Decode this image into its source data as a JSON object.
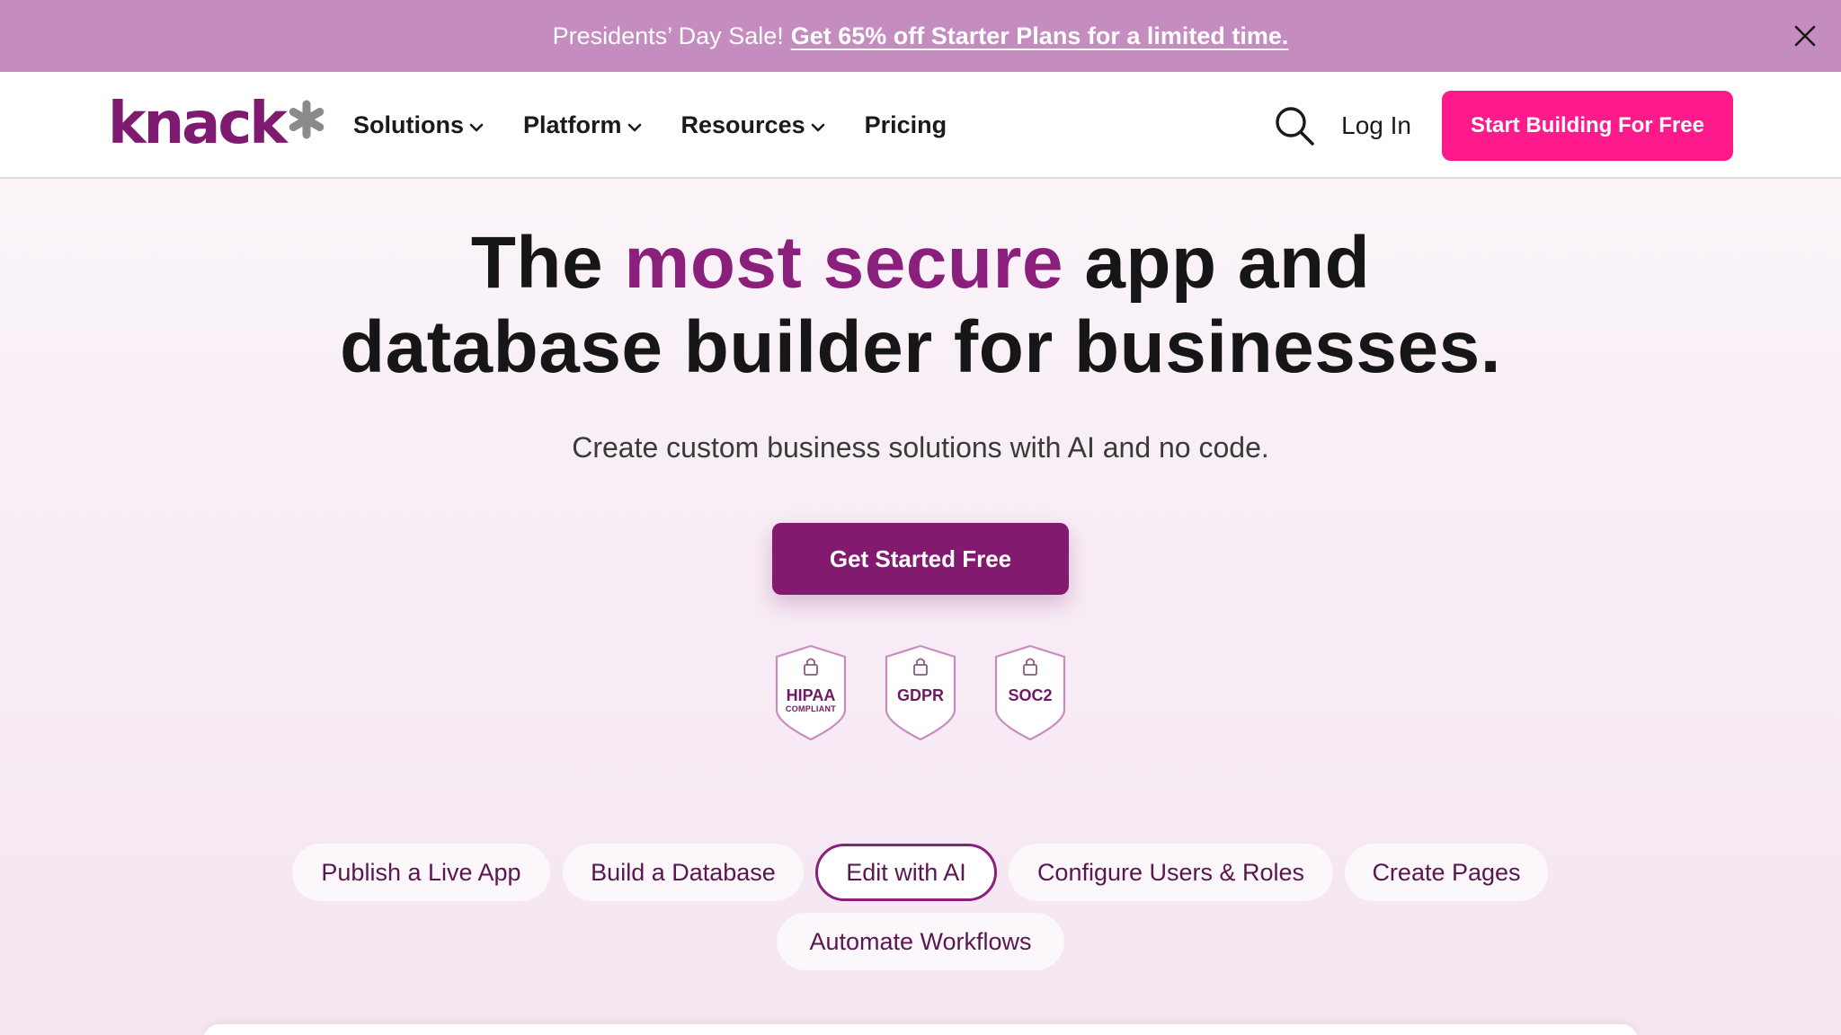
{
  "promo": {
    "lead": "Presidents’ Day Sale!",
    "link": "Get 65% off Starter Plans for a limited time.",
    "close_icon": "close-icon"
  },
  "header": {
    "logo_text": "knack",
    "logo_icon": "asterisk-logo-icon",
    "nav": [
      {
        "label": "Solutions",
        "has_dropdown": true
      },
      {
        "label": "Platform",
        "has_dropdown": true
      },
      {
        "label": "Resources",
        "has_dropdown": true
      },
      {
        "label": "Pricing",
        "has_dropdown": false
      }
    ],
    "search_icon": "search-icon",
    "login": "Log In",
    "cta": "Start Building For Free"
  },
  "hero": {
    "title_part1": "The ",
    "title_accent": "most secure",
    "title_part2": " app and",
    "title_line2": "database builder for businesses.",
    "subtitle": "Create custom business solutions with AI and no code.",
    "cta": "Get Started Free"
  },
  "badges": [
    {
      "label": "HIPAA",
      "sublabel": "COMPLIANT",
      "icon": "lock-icon"
    },
    {
      "label": "GDPR",
      "sublabel": "",
      "icon": "lock-icon"
    },
    {
      "label": "SOC2",
      "sublabel": "",
      "icon": "lock-icon"
    }
  ],
  "feature_tabs": [
    {
      "label": "Publish a Live App",
      "active": false
    },
    {
      "label": "Build a Database",
      "active": false
    },
    {
      "label": "Edit with AI",
      "active": true
    },
    {
      "label": "Configure Users & Roles",
      "active": false
    },
    {
      "label": "Create Pages",
      "active": false
    },
    {
      "label": "Automate Workflows",
      "active": false
    }
  ],
  "colors": {
    "banner": "#c48cbf",
    "brand": "#821a6f",
    "accent_pink": "#ff1a8c"
  }
}
